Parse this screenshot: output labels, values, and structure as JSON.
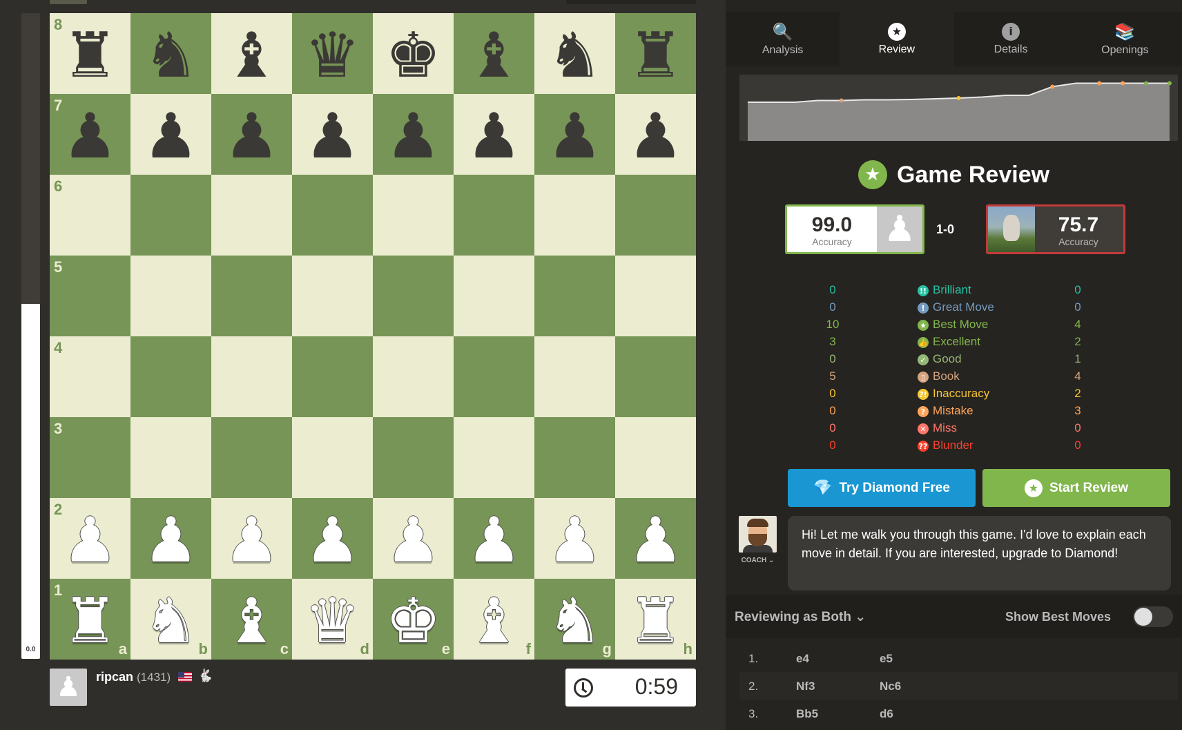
{
  "eval": {
    "text": "0.0",
    "white_fraction": 0.55
  },
  "board": {
    "ranks": [
      "8",
      "7",
      "6",
      "5",
      "4",
      "3",
      "2",
      "1"
    ],
    "files": [
      "a",
      "b",
      "c",
      "d",
      "e",
      "f",
      "g",
      "h"
    ],
    "position": [
      [
        "br",
        "bn",
        "bb",
        "bq",
        "bk",
        "bb",
        "bn",
        "br"
      ],
      [
        "bp",
        "bp",
        "bp",
        "bp",
        "bp",
        "bp",
        "bp",
        "bp"
      ],
      [
        "",
        "",
        "",
        "",
        "",
        "",
        "",
        ""
      ],
      [
        "",
        "",
        "",
        "",
        "",
        "",
        "",
        ""
      ],
      [
        "",
        "",
        "",
        "",
        "",
        "",
        "",
        ""
      ],
      [
        "",
        "",
        "",
        "",
        "",
        "",
        "",
        ""
      ],
      [
        "wp",
        "wp",
        "wp",
        "wp",
        "wp",
        "wp",
        "wp",
        "wp"
      ],
      [
        "wr",
        "wn",
        "wb",
        "wq",
        "wk",
        "wb",
        "wn",
        "wr"
      ]
    ],
    "light_color": "#ebecd0",
    "dark_color": "#779556"
  },
  "player_bottom": {
    "name": "ripcan",
    "rating": "(1431)",
    "clock": "0:59"
  },
  "tabs": [
    {
      "label": "Analysis",
      "icon": "magnifier-icon",
      "active": false
    },
    {
      "label": "Review",
      "icon": "star-circle-icon",
      "active": true
    },
    {
      "label": "Details",
      "icon": "info-icon",
      "active": false
    },
    {
      "label": "Openings",
      "icon": "book-icon",
      "active": false
    }
  ],
  "review": {
    "title": "Game Review",
    "white_accuracy": "99.0",
    "black_accuracy": "75.7",
    "accuracy_label": "Accuracy",
    "score": "1-0"
  },
  "stats": [
    {
      "label": "Brilliant",
      "white": "0",
      "black": "0",
      "color": "#26c2a3",
      "icon": "!!"
    },
    {
      "label": "Great Move",
      "white": "0",
      "black": "0",
      "color": "#749bbf",
      "icon": "!"
    },
    {
      "label": "Best Move",
      "white": "10",
      "black": "4",
      "color": "#81b64c",
      "icon": "★"
    },
    {
      "label": "Excellent",
      "white": "3",
      "black": "2",
      "color": "#81b64c",
      "icon": "👍"
    },
    {
      "label": "Good",
      "white": "0",
      "black": "1",
      "color": "#95b776",
      "icon": "✓"
    },
    {
      "label": "Book",
      "white": "5",
      "black": "4",
      "color": "#d5a47d",
      "icon": "▯"
    },
    {
      "label": "Inaccuracy",
      "white": "0",
      "black": "2",
      "color": "#f7c631",
      "icon": "?!"
    },
    {
      "label": "Mistake",
      "white": "0",
      "black": "3",
      "color": "#ffa459",
      "icon": "?"
    },
    {
      "label": "Miss",
      "white": "0",
      "black": "0",
      "color": "#ff7769",
      "icon": "✕"
    },
    {
      "label": "Blunder",
      "white": "0",
      "black": "0",
      "color": "#fa412d",
      "icon": "??"
    }
  ],
  "buttons": {
    "diamond": "Try Diamond Free",
    "start_review": "Start Review"
  },
  "coach": {
    "label": "COACH ⌄",
    "message": "Hi! Let me walk you through this game. I'd love to explain each move in detail. If you are interested, upgrade to Diamond!"
  },
  "review_bar": {
    "reviewing_as": "Reviewing as Both ⌄",
    "show_best": "Show Best Moves",
    "show_best_on": false
  },
  "moves": [
    {
      "num": "1.",
      "white": "e4",
      "black": "e5"
    },
    {
      "num": "2.",
      "white": "Nf3",
      "black": "Nc6"
    },
    {
      "num": "3.",
      "white": "Bb5",
      "black": "d6"
    }
  ],
  "graph": {
    "values": [
      0,
      0,
      0,
      0.05,
      0.05,
      0.07,
      0.07,
      0.08,
      0.1,
      0.12,
      0.15,
      0.2,
      0.2,
      0.45,
      0.55,
      0.55,
      0.55,
      0.55,
      0.55
    ]
  }
}
